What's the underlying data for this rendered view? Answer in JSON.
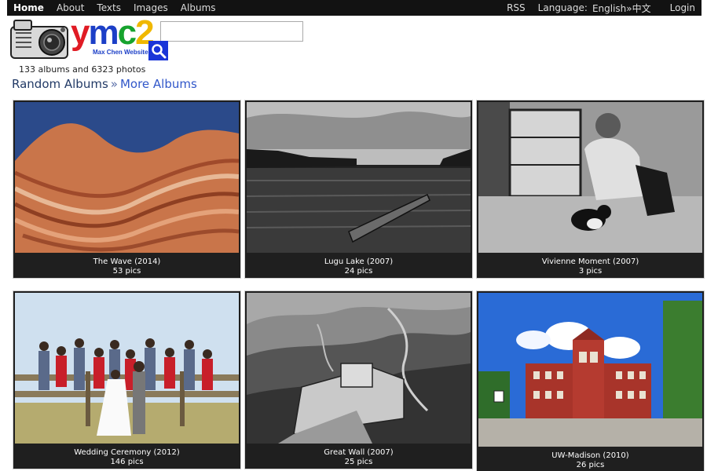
{
  "nav": {
    "left": [
      {
        "label": "Home",
        "active": true
      },
      {
        "label": "About",
        "active": false
      },
      {
        "label": "Texts",
        "active": false
      },
      {
        "label": "Images",
        "active": false
      },
      {
        "label": "Albums",
        "active": false
      }
    ],
    "rss": "RSS",
    "language_label": "Language:",
    "language_value": "English»中文",
    "login": "Login"
  },
  "logo": {
    "y": "y",
    "m": "m",
    "c": "c",
    "two": "2",
    "subtitle": "Max Chen Website"
  },
  "search": {
    "value": "",
    "placeholder": ""
  },
  "stats": "133 albums and 6323 photos",
  "heading": {
    "title": "Random Albums",
    "separator": "»",
    "more": "More Albums"
  },
  "albums": [
    {
      "title": "The Wave (2014)",
      "count": "53 pics"
    },
    {
      "title": "Lugu Lake (2007)",
      "count": "24 pics"
    },
    {
      "title": "Vivienne Moment (2007)",
      "count": "3 pics"
    },
    {
      "title": "Wedding Ceremony (2012)",
      "count": "146 pics"
    },
    {
      "title": "Great Wall (2007)",
      "count": "25 pics"
    },
    {
      "title": "UW-Madison (2010)",
      "count": "26 pics"
    }
  ],
  "colors": {
    "nav_bg": "#121212",
    "search_button": "#1a35d8",
    "card_bg": "#1f1f1f",
    "link": "#3157c9"
  },
  "icons": {
    "search": "magnifier-icon",
    "camera": "camera-logo-icon"
  }
}
